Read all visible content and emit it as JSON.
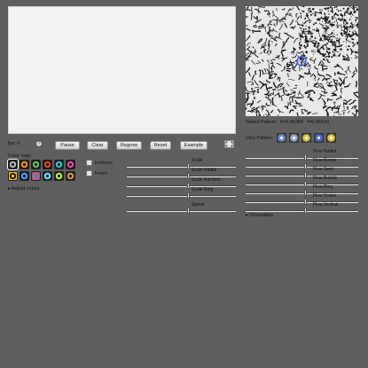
{
  "status": {
    "fps": "fps: 0",
    "help": "?"
  },
  "buttons": {
    "pause": "Pause",
    "clear": "Clear",
    "regrow": "Regrow",
    "reset": "Reset",
    "example": "Example"
  },
  "colormap": {
    "label": "Color map:",
    "swatches": [
      {
        "name": "gray",
        "colors": [
          "#1a1a1a",
          "#bfbfbf"
        ]
      },
      {
        "name": "orange",
        "colors": [
          "#2b1a0a",
          "#f09a3a"
        ]
      },
      {
        "name": "green",
        "colors": [
          "#0c2410",
          "#6cc46a"
        ]
      },
      {
        "name": "red",
        "colors": [
          "#280808",
          "#e04a3a"
        ]
      },
      {
        "name": "teal",
        "colors": [
          "#06242a",
          "#3ec4c8"
        ]
      },
      {
        "name": "pink",
        "colors": [
          "#2a0a20",
          "#e05aa8"
        ]
      },
      {
        "name": "yellow",
        "colors": [
          "#e8c23a",
          "#2a1a08"
        ]
      },
      {
        "name": "blue",
        "colors": [
          "#0a1a3a",
          "#6aa0f0"
        ]
      },
      {
        "name": "rainbow",
        "colors": [
          "#f04040",
          "#3a90f0"
        ]
      },
      {
        "name": "cyan",
        "colors": [
          "#0a2a3a",
          "#8ae0f8"
        ]
      },
      {
        "name": "lime",
        "colors": [
          "#1a2a08",
          "#c8f060"
        ]
      },
      {
        "name": "brown",
        "colors": [
          "#2a1a08",
          "#d8a060"
        ]
      }
    ],
    "adjust": "Adjust colors"
  },
  "checkboxes": {
    "emboss": "Emboss",
    "invert": "Invert"
  },
  "sliders_left": [
    {
      "label": "Scale",
      "value": 0.55
    },
    {
      "label": "Scale Radial",
      "value": 0.55
    },
    {
      "label": "Scale Random",
      "value": 0.55
    },
    {
      "label": "Scale Ring",
      "value": 0.55
    },
    {
      "label": "Speed",
      "value": 0.55
    }
  ],
  "pattern": {
    "select": "Select Pattern",
    "k": "k=0.06264",
    "f": "f=0.06100",
    "vary": "Vary Pattern:",
    "vary_colors": [
      "#6a8ad8",
      "#9aa8c8",
      "#d8c84a",
      "#4a6ad8",
      "#e8c83a"
    ]
  },
  "sliders_right": [
    {
      "label": "Flow Radial",
      "value": 0.52
    },
    {
      "label": "Flow Rotate",
      "value": 0.52
    },
    {
      "label": "Flow Swirl",
      "value": 0.52
    },
    {
      "label": "Flow Bubble",
      "value": 0.52
    },
    {
      "label": "Flow Ring",
      "value": 0.52
    },
    {
      "label": "Flow Vortex",
      "value": 0.52
    },
    {
      "label": "Flow Vertical",
      "value": 0.52
    }
  ],
  "orientation": "Orientation"
}
